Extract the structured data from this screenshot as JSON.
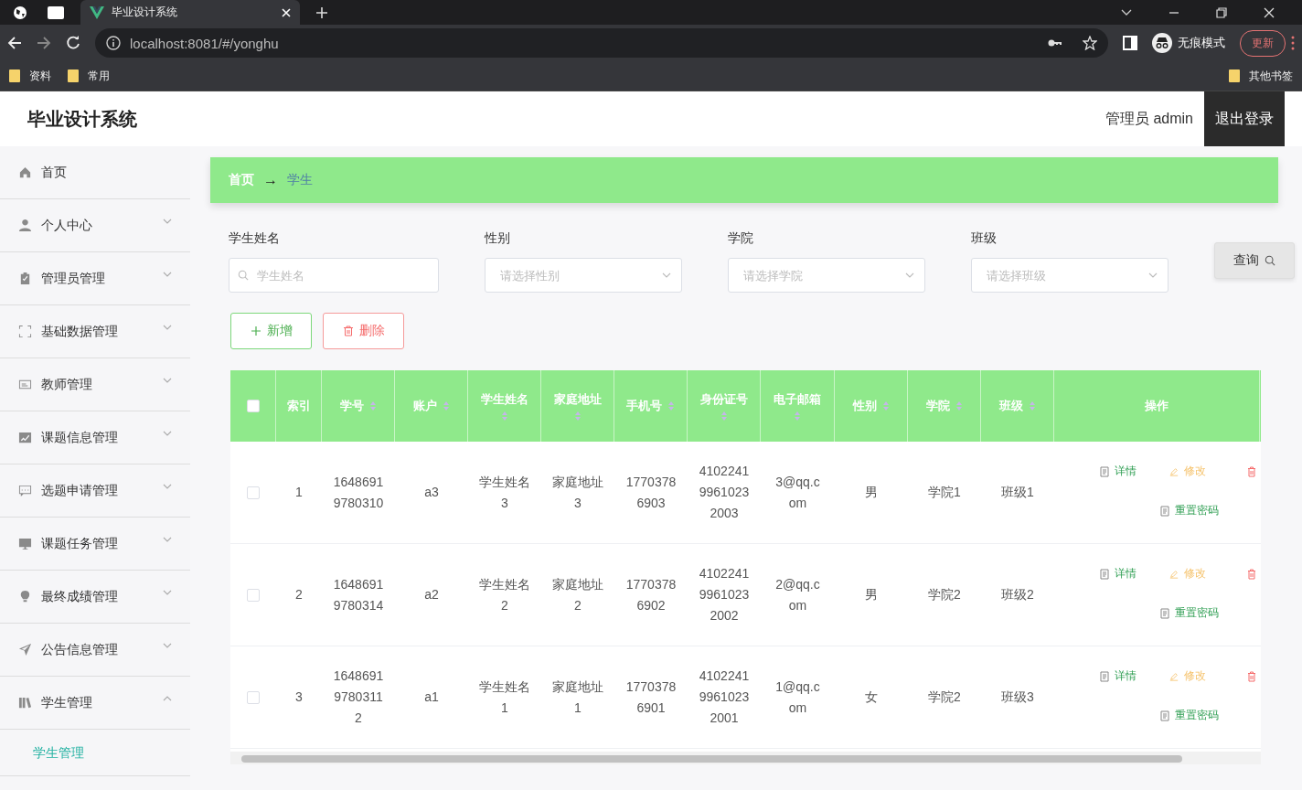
{
  "browser": {
    "tabs": [
      {
        "title": "毕业设计系统",
        "selected": true
      }
    ],
    "address": "localhost:8081/#/yonghu",
    "profile": "无痕模式",
    "update_button": "更新",
    "bookmarks": [
      "资料",
      "常用"
    ],
    "other_bookmarks": "其他书签"
  },
  "header": {
    "title": "毕业设计系统",
    "user": "管理员 admin",
    "logout": "退出登录"
  },
  "sidebar": {
    "items": [
      {
        "label": "首页",
        "kind": "link"
      },
      {
        "label": "个人中心",
        "kind": "submenu",
        "expanded": false
      },
      {
        "label": "管理员管理",
        "kind": "submenu",
        "expanded": false
      },
      {
        "label": "基础数据管理",
        "kind": "submenu",
        "expanded": false
      },
      {
        "label": "教师管理",
        "kind": "submenu",
        "expanded": false
      },
      {
        "label": "课题信息管理",
        "kind": "submenu",
        "expanded": false
      },
      {
        "label": "选题申请管理",
        "kind": "submenu",
        "expanded": false
      },
      {
        "label": "课题任务管理",
        "kind": "submenu",
        "expanded": false
      },
      {
        "label": "最终成绩管理",
        "kind": "submenu",
        "expanded": false
      },
      {
        "label": "公告信息管理",
        "kind": "submenu",
        "expanded": false
      },
      {
        "label": "学生管理",
        "kind": "submenu",
        "expanded": true,
        "children": [
          {
            "label": "学生管理",
            "selected": true
          }
        ]
      }
    ]
  },
  "breadcrumb": {
    "separator": "→",
    "items": [
      {
        "label": "首页",
        "selected": false
      },
      {
        "label": "学生",
        "selected": true
      }
    ]
  },
  "filters": [
    {
      "label": "学生姓名",
      "kind": "search",
      "placeholder": "学生姓名"
    },
    {
      "label": "性别",
      "kind": "select",
      "placeholder": "请选择性别"
    },
    {
      "label": "学院",
      "kind": "select",
      "placeholder": "请选择学院"
    },
    {
      "label": "班级",
      "kind": "select",
      "placeholder": "请选择班级"
    }
  ],
  "search_button": "查询",
  "add_button": "新增",
  "delete_button": "删除",
  "table": {
    "all_checked": false,
    "columns": [
      {
        "label": "索引",
        "sortable": false
      },
      {
        "label": "学号",
        "sortable": true
      },
      {
        "label": "账户",
        "sortable": true
      },
      {
        "label": "学生姓名",
        "sortable": true
      },
      {
        "label": "家庭地址",
        "sortable": true
      },
      {
        "label": "手机号",
        "sortable": true
      },
      {
        "label": "身份证号",
        "sortable": true
      },
      {
        "label": "电子邮箱",
        "sortable": true
      },
      {
        "label": "性别",
        "sortable": true
      },
      {
        "label": "学院",
        "sortable": true
      },
      {
        "label": "班级",
        "sortable": true
      },
      {
        "label": "操作",
        "sortable": false
      }
    ],
    "rows": [
      {
        "checked": false,
        "cells": [
          "1",
          "16486919780310",
          "a3",
          "学生姓名 3",
          "家庭地址 3",
          "17703786903",
          "410224199610232003",
          "3@qq.com",
          "男",
          "学院1",
          "班级1"
        ],
        "detail": "详情",
        "edit": "修改",
        "reset": "重置密码"
      },
      {
        "checked": false,
        "cells": [
          "2",
          "16486919780314",
          "a2",
          "学生姓名 2",
          "家庭地址 2",
          "17703786902",
          "410224199610232002",
          "2@qq.com",
          "男",
          "学院2",
          "班级2"
        ],
        "detail": "详情",
        "edit": "修改",
        "reset": "重置密码"
      },
      {
        "checked": false,
        "cells": [
          "3",
          "164869197803112",
          "a1",
          "学生姓名 1",
          "家庭地址 1",
          "17703786901",
          "410224199610232001",
          "1@qq.com",
          "女",
          "学院2",
          "班级3"
        ],
        "detail": "详情",
        "edit": "修改",
        "reset": "重置密码"
      }
    ]
  }
}
